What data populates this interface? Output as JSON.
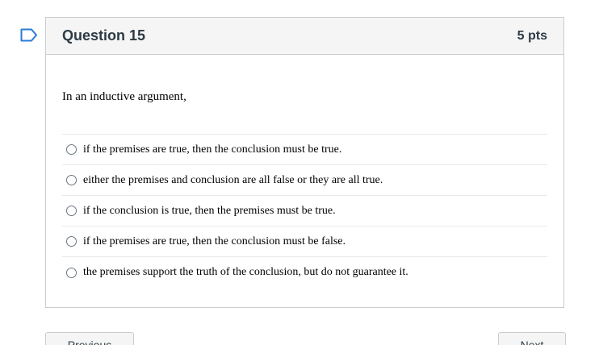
{
  "question": {
    "title": "Question 15",
    "points": "5 pts",
    "text": "In an inductive argument,",
    "answers": [
      {
        "label": "if the premises are true, then the conclusion must be true."
      },
      {
        "label": "either the premises and conclusion are all false or they are all true."
      },
      {
        "label": "if the conclusion is true, then the premises must be true."
      },
      {
        "label": "if the premises are true, then the conclusion must be false."
      },
      {
        "label": "the premises support the truth of the conclusion, but do not guarantee it."
      }
    ]
  },
  "navigation": {
    "previous_label": "Previous",
    "next_label": "Next"
  },
  "colors": {
    "flag_outline": "#2d7bd6",
    "header_bg": "#f5f5f5",
    "border": "#c7cdd1"
  },
  "icons": {
    "flag": "bookmark-flag-icon",
    "radio": "radio-button-icon"
  }
}
